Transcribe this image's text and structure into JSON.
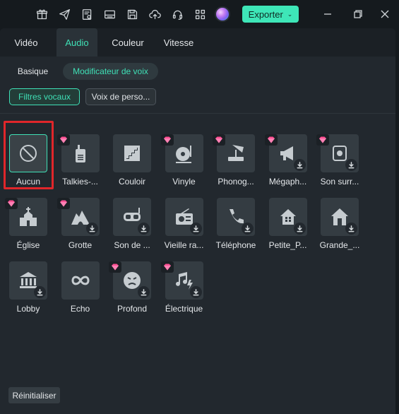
{
  "titlebar": {
    "export_label": "Exporter",
    "icons": [
      "gift-icon",
      "send-icon",
      "document-cog-icon",
      "keyboard-icon",
      "save-icon",
      "cloud-upload-icon",
      "headset-icon",
      "grid-icon",
      "ai-orb-icon"
    ],
    "window_controls": [
      "minimize-icon",
      "restore-icon",
      "close-icon"
    ]
  },
  "tabs": [
    {
      "label": "Vidéo",
      "active": false
    },
    {
      "label": "Audio",
      "active": true
    },
    {
      "label": "Couleur",
      "active": false
    },
    {
      "label": "Vitesse",
      "active": false
    }
  ],
  "subtabs": [
    {
      "label": "Basique",
      "active": false
    },
    {
      "label": "Modificateur de voix",
      "active": true
    }
  ],
  "filter_pills": [
    {
      "label": "Filtres vocaux",
      "active": true
    },
    {
      "label": "Voix de perso...",
      "active": false
    }
  ],
  "effects": [
    {
      "label": "Aucun",
      "icon": "none-icon",
      "premium": false,
      "download": false,
      "selected": true
    },
    {
      "label": "Talkies-...",
      "icon": "walkie-talkie-icon",
      "premium": true,
      "download": false
    },
    {
      "label": "Couloir",
      "icon": "stairs-icon",
      "premium": false,
      "download": false
    },
    {
      "label": "Vinyle",
      "icon": "turntable-icon",
      "premium": true,
      "download": false
    },
    {
      "label": "Phonog...",
      "icon": "phonograph-icon",
      "premium": true,
      "download": false
    },
    {
      "label": "Mégaph...",
      "icon": "megaphone-icon",
      "premium": true,
      "download": true
    },
    {
      "label": "Son surr...",
      "icon": "surround-speaker-icon",
      "premium": true,
      "download": true
    },
    {
      "label": "Église",
      "icon": "church-icon",
      "premium": true,
      "download": false
    },
    {
      "label": "Grotte",
      "icon": "cave-icon",
      "premium": true,
      "download": true
    },
    {
      "label": "Son de ...",
      "icon": "diving-mask-icon",
      "premium": false,
      "download": true
    },
    {
      "label": "Vieille ra...",
      "icon": "old-radio-icon",
      "premium": false,
      "download": true
    },
    {
      "label": "Téléphone",
      "icon": "phone-icon",
      "premium": false,
      "download": true
    },
    {
      "label": "Petite_P...",
      "icon": "small-house-icon",
      "premium": false,
      "download": true
    },
    {
      "label": "Grande_...",
      "icon": "large-house-icon",
      "premium": false,
      "download": true
    },
    {
      "label": "Lobby",
      "icon": "bank-icon",
      "premium": false,
      "download": true
    },
    {
      "label": "Echo",
      "icon": "infinity-icon",
      "premium": false,
      "download": false
    },
    {
      "label": "Profond",
      "icon": "deep-face-icon",
      "premium": true,
      "download": true
    },
    {
      "label": "Électrique",
      "icon": "electric-music-icon",
      "premium": true,
      "download": true
    }
  ],
  "reset_label": "Réinitialiser",
  "colors": {
    "accent": "#3fe0b6",
    "premium_gem": "#ff4f93",
    "selection_frame": "#e0262a"
  }
}
